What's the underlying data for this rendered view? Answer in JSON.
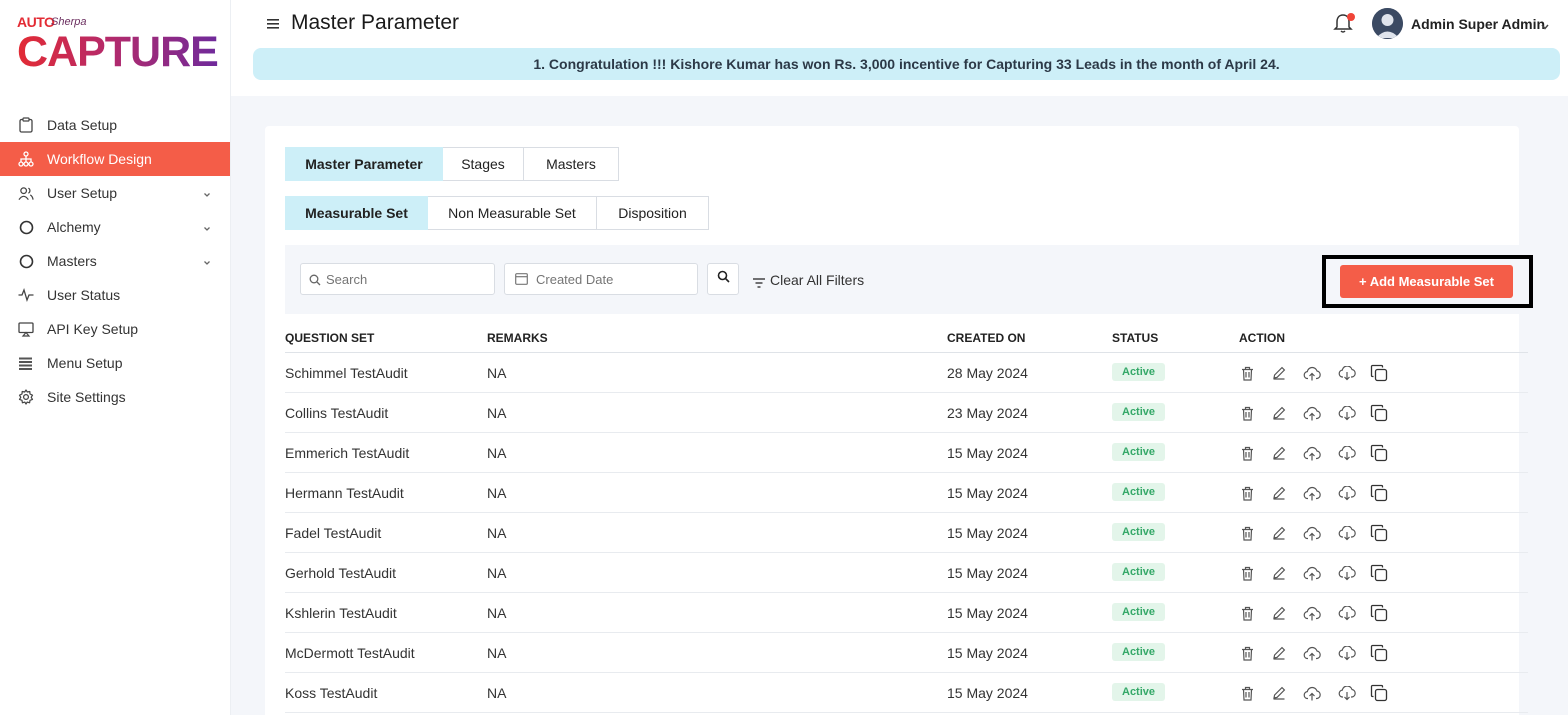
{
  "brand": {
    "auto": "AUTO",
    "sherpa": "Sherpa",
    "capture": "CAPTURE"
  },
  "sidebar": {
    "items": [
      {
        "label": "Data Setup",
        "icon": "clipboard-icon",
        "active": false,
        "expandable": false
      },
      {
        "label": "Workflow Design",
        "icon": "sitemap-icon",
        "active": true,
        "expandable": false
      },
      {
        "label": "User Setup",
        "icon": "users-icon",
        "active": false,
        "expandable": true
      },
      {
        "label": "Alchemy",
        "icon": "circle-icon",
        "active": false,
        "expandable": true
      },
      {
        "label": "Masters",
        "icon": "circle-icon",
        "active": false,
        "expandable": true
      },
      {
        "label": "User Status",
        "icon": "activity-icon",
        "active": false,
        "expandable": false
      },
      {
        "label": "API Key Setup",
        "icon": "monitor-icon",
        "active": false,
        "expandable": false
      },
      {
        "label": "Menu Setup",
        "icon": "list-icon",
        "active": false,
        "expandable": false
      },
      {
        "label": "Site Settings",
        "icon": "gear-icon",
        "active": false,
        "expandable": false
      }
    ]
  },
  "header": {
    "title": "Master Parameter",
    "user_name": "Admin Super Admin",
    "banner": "1. Congratulation !!! Kishore Kumar has won Rs. 3,000 incentive for Capturing 33 Leads in the month of April 24."
  },
  "tabs_primary": [
    {
      "label": "Master Parameter",
      "active": true
    },
    {
      "label": "Stages",
      "active": false
    },
    {
      "label": "Masters",
      "active": false
    }
  ],
  "tabs_secondary": [
    {
      "label": "Measurable Set",
      "active": true
    },
    {
      "label": "Non Measurable Set",
      "active": false
    },
    {
      "label": "Disposition",
      "active": false
    }
  ],
  "filters": {
    "search_placeholder": "Search",
    "date_placeholder": "Created Date",
    "clear_label": "Clear All Filters",
    "add_label": "+ Add Measurable Set"
  },
  "table": {
    "headers": {
      "question_set": "QUESTION SET",
      "remarks": "REMARKS",
      "created_on": "CREATED ON",
      "status": "STATUS",
      "action": "ACTION"
    },
    "rows": [
      {
        "question_set": "Schimmel TestAudit",
        "remarks": "NA",
        "created_on": "28 May 2024",
        "status": "Active"
      },
      {
        "question_set": "Collins TestAudit",
        "remarks": "NA",
        "created_on": "23 May 2024",
        "status": "Active"
      },
      {
        "question_set": "Emmerich TestAudit",
        "remarks": "NA",
        "created_on": "15 May 2024",
        "status": "Active"
      },
      {
        "question_set": "Hermann TestAudit",
        "remarks": "NA",
        "created_on": "15 May 2024",
        "status": "Active"
      },
      {
        "question_set": "Fadel TestAudit",
        "remarks": "NA",
        "created_on": "15 May 2024",
        "status": "Active"
      },
      {
        "question_set": "Gerhold TestAudit",
        "remarks": "NA",
        "created_on": "15 May 2024",
        "status": "Active"
      },
      {
        "question_set": "Kshlerin TestAudit",
        "remarks": "NA",
        "created_on": "15 May 2024",
        "status": "Active"
      },
      {
        "question_set": "McDermott TestAudit",
        "remarks": "NA",
        "created_on": "15 May 2024",
        "status": "Active"
      },
      {
        "question_set": "Koss TestAudit",
        "remarks": "NA",
        "created_on": "15 May 2024",
        "status": "Active"
      }
    ]
  },
  "colors": {
    "accent": "#f45d48",
    "tab_active": "#cdeff8",
    "banner": "#cdeff8",
    "status_active_bg": "#e3f5ea",
    "status_active_text": "#34a868"
  }
}
